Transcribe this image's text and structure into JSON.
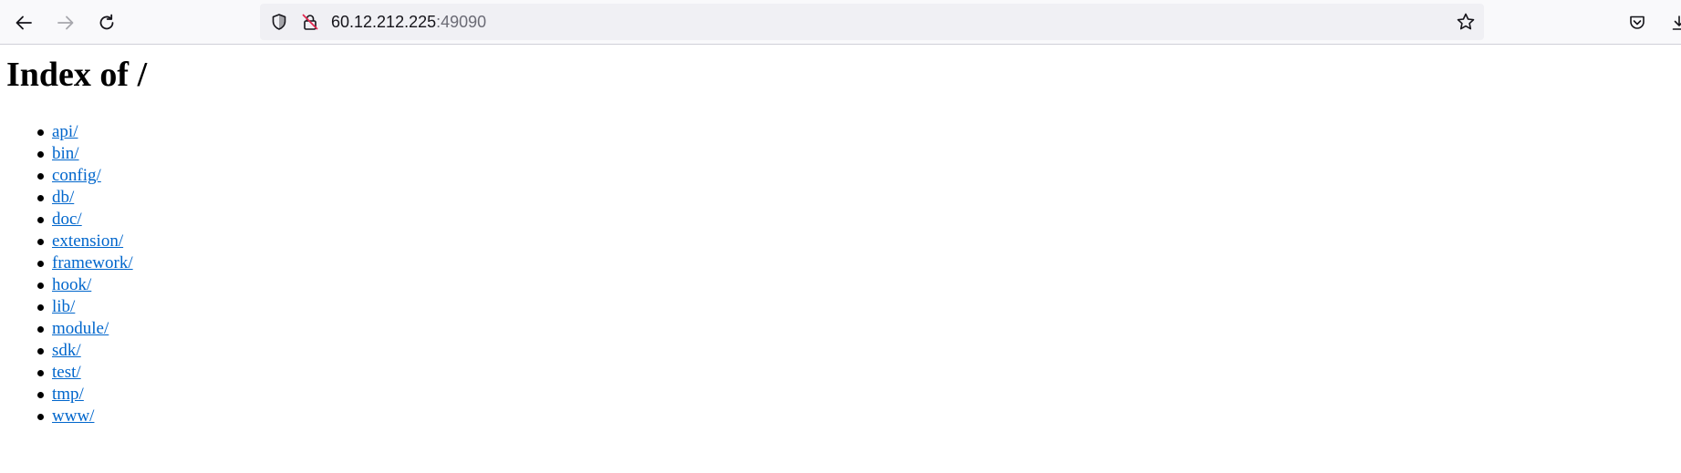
{
  "browser": {
    "address": {
      "host": "60.12.212.225",
      "port": ":49090"
    },
    "icons": {
      "back": "arrow-left-icon",
      "forward": "arrow-right-icon",
      "reload": "reload-icon",
      "tracking": "shield-icon",
      "security": "insecure-lock-icon",
      "bookmark": "star-icon",
      "pocket": "pocket-icon",
      "downloads": "download-icon"
    }
  },
  "page": {
    "title": "Index of /",
    "entries": [
      "api/",
      "bin/",
      "config/",
      "db/",
      "doc/",
      "extension/",
      "framework/",
      "hook/",
      "lib/",
      "module/",
      "sdk/",
      "test/",
      "tmp/",
      "www/"
    ]
  },
  "colors": {
    "link": "#0066cc",
    "toolbar_bg": "#f9f9fb",
    "urlbar_bg": "#f0f0f4"
  }
}
